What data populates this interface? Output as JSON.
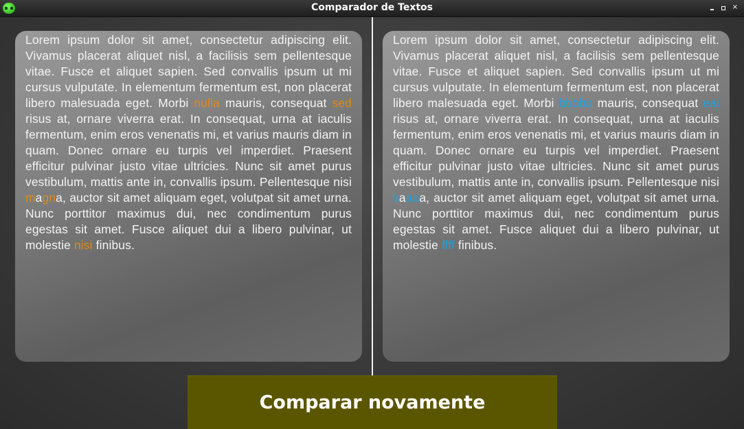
{
  "window": {
    "title": "Comparador de Textos",
    "icon": "green-app-icon"
  },
  "colors": {
    "diff_left": "#e08a16",
    "diff_right": "#1fa2dc",
    "button_bg": "#5a5600"
  },
  "left_text": {
    "t1": "Lorem ipsum dolor sit amet, consectetur adipiscing elit. Vivamus placerat aliquet nisl, a facilisis sem pellentesque vitae. Fusce et aliquet sapien. Sed convallis ipsum ut mi cursus vulputate. In elementum fermentum est, non placerat libero malesuada eget. Morbi ",
    "d1": "nulla",
    "t2": " mauris, consequat ",
    "d2": "sed",
    "t3": " risus at, ornare viverra erat. In consequat, urna at iaculis fermentum, enim eros venenatis mi, et varius mauris diam in quam. Donec ornare eu turpis vel imperdiet. Praesent efficitur pulvinar justo vitae ultricies. Nunc sit amet purus vestibulum, mattis ante in, convallis ipsum. Pellentesque nisi ",
    "d3a": "m",
    "t4": "a",
    "d3b": "gn",
    "t5": "a, auctor sit amet aliquam eget, volutpat sit amet urna. Nunc porttitor maximus dui, nec condimentum purus egestas sit amet. Fusce aliquet dui a libero pulvinar, ut molestie ",
    "d4": "nisi",
    "t6": " finibus."
  },
  "right_text": {
    "t1": "Lorem ipsum dolor sit amet, consectetur adipiscing elit. Vivamus placerat aliquet nisl, a facilisis sem pellentesque vitae. Fusce et aliquet sapien. Sed convallis ipsum ut mi cursus vulputate. In elementum fermentum est, non placerat libero malesuada eget. Morbi ",
    "d1": "bbbbb",
    "t2": " mauris, consequat ",
    "d2": "eai",
    "t3": " risus at, ornare viverra erat. In consequat, urna at iaculis fermentum, enim eros venenatis mi, et varius mauris diam in quam. Donec ornare eu turpis vel imperdiet. Praesent efficitur pulvinar justo vitae ultricies. Nunc sit amet purus vestibulum, mattis ante in, convallis ipsum. Pellentesque nisi ",
    "d3a": "s",
    "t4": "a",
    "d3b": "aa",
    "t5": "a, auctor sit amet aliquam eget, volutpat sit amet urna. Nunc porttitor maximus dui, nec condimentum purus egestas sit amet. Fusce aliquet dui a libero pulvinar, ut molestie ",
    "d4": "ffff",
    "t6": " finibus."
  },
  "compare_button": {
    "label": "Comparar novamente"
  }
}
